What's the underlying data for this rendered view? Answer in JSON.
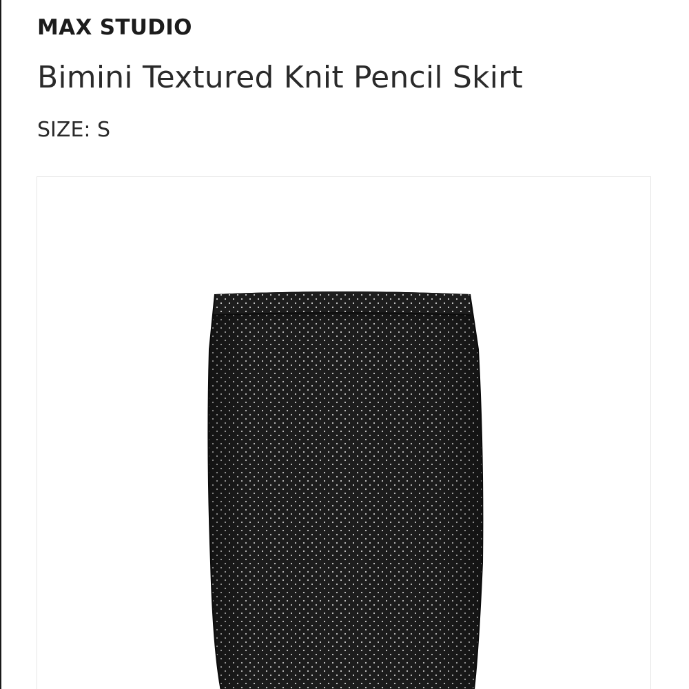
{
  "product": {
    "brand": "MAX STUDIO",
    "name": "Bimini Textured Knit Pencil Skirt",
    "size_label": "SIZE: S"
  },
  "image": {
    "alt": "Black pencil skirt with small white dot texture",
    "colors": {
      "fabric": "#1d1d1d",
      "dots": "#cfcfcf",
      "background": "#ffffff",
      "card_border": "#e6e6e6"
    }
  }
}
